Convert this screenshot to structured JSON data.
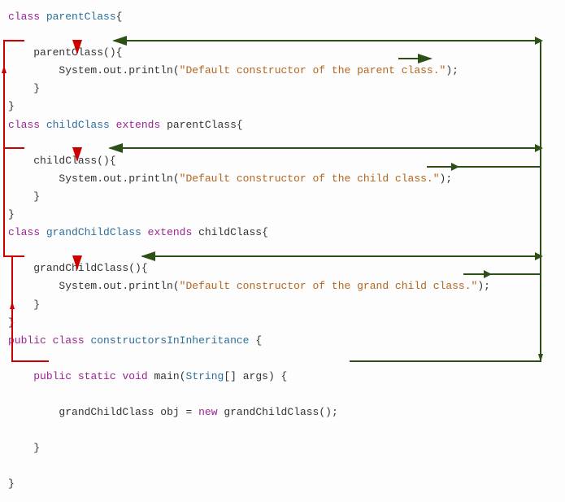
{
  "line1_kw": "class",
  "line1_name": "parentClass",
  "line1_brace": "{",
  "line3_name": "parentClass",
  "line3_parens": "(){",
  "line4_call": "System.out.println",
  "line4_str": "\"Default constructor of the parent class.\"",
  "line4_end": ");",
  "line5": "}",
  "line6": "}",
  "line7_kw": "class",
  "line7_name": "childClass",
  "line7_ext": "extends",
  "line7_parent": "parentClass",
  "line7_brace": "{",
  "line9_name": "childClass",
  "line9_parens": "(){",
  "line10_call": "System.out.println",
  "line10_str": "\"Default constructor of the child class.\"",
  "line10_end": ");",
  "line11": "}",
  "line12": "}",
  "line13_kw": "class",
  "line13_name": "grandChildClass",
  "line13_ext": "extends",
  "line13_parent": "childClass",
  "line13_brace": "{",
  "line15_name": "grandChildClass",
  "line15_parens": "(){",
  "line16_call": "System.out.println",
  "line16_str": "\"Default constructor of the grand child class.\"",
  "line16_end": ");",
  "line17": "}",
  "line18": "}",
  "line19_pub": "public",
  "line19_kw": "class",
  "line19_name": "constructorsInInheritance",
  "line19_brace": "{",
  "line21_pub": "public",
  "line21_stat": "static",
  "line21_void": "void",
  "line21_main": "main",
  "line21_arg_type": "String",
  "line21_arg_rest": "[] args) {",
  "line23_type": "grandChildClass",
  "line23_obj": "obj",
  "line23_eq": "=",
  "line23_new": "new",
  "line23_ctor": "grandChildClass",
  "line23_end": "();",
  "line25": "}",
  "line27": "}"
}
